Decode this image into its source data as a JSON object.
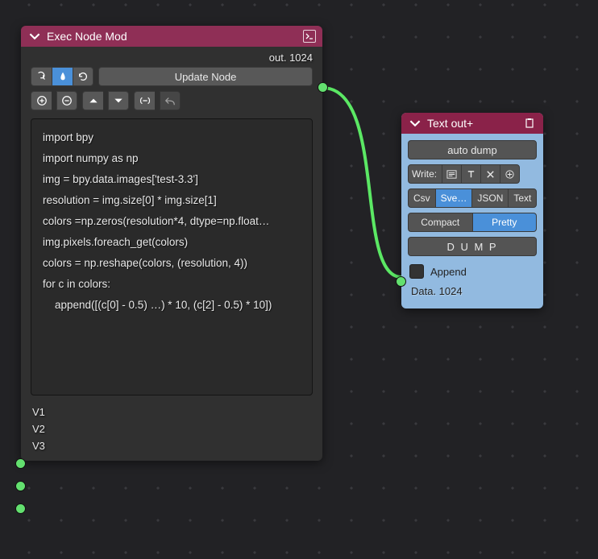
{
  "exec_node": {
    "title": "Exec Node Mod",
    "out_label": "out. 1024",
    "update_btn": "Update Node",
    "code_lines": [
      "import bpy",
      "import numpy as np",
      "img = bpy.data.images['test-3.3']",
      "resolution = img.size[0] * img.size[1]",
      "colors =np.zeros(resolution*4, dtype=np.float…",
      "img.pixels.foreach_get(colors)",
      "colors = np.reshape(colors, (resolution, 4))",
      "for c in colors:",
      "    append([(c[0] - 0.5) …) * 10, (c[2] - 0.5) * 10])"
    ],
    "inputs": [
      "V1",
      "V2",
      "V3"
    ]
  },
  "textout_node": {
    "title": "Text out+",
    "auto_dump": "auto dump",
    "write_label": "Write:",
    "fmt": {
      "csv": "Csv",
      "sver": "Sve…",
      "json": "JSON",
      "text": "Text"
    },
    "style": {
      "compact": "Compact",
      "pretty": "Pretty"
    },
    "dump": "D U M P",
    "append": "Append",
    "data_label": "Data. 1024"
  }
}
